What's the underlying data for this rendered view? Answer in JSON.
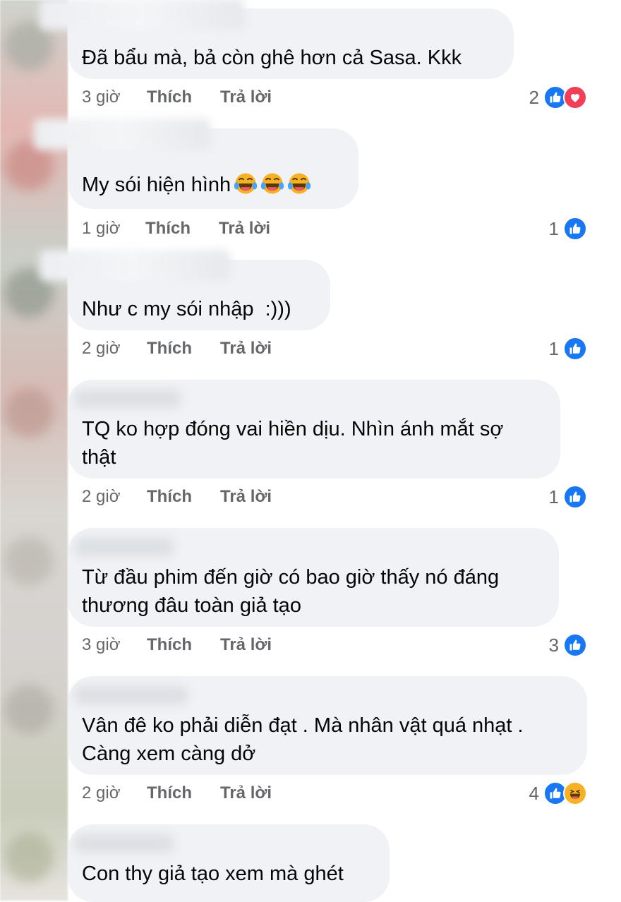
{
  "comments": [
    {
      "text": "Đã bẩu mà, bả còn ghê hơn cả Sasa. Kkk",
      "time": "3 giờ",
      "like": "Thích",
      "reply": "Trả lời",
      "count": "2",
      "reactions": [
        "like",
        "love"
      ]
    },
    {
      "text": "My sói hiện hình",
      "emojis": [
        "laughing-tears",
        "laughing-tears",
        "laughing-tears"
      ],
      "time": "1 giờ",
      "like": "Thích",
      "reply": "Trả lời",
      "count": "1",
      "reactions": [
        "like"
      ]
    },
    {
      "text": "Như c my sói nhập  :)))",
      "time": "2 giờ",
      "like": "Thích",
      "reply": "Trả lời",
      "count": "1",
      "reactions": [
        "like"
      ]
    },
    {
      "text_lines": [
        "TQ ko hợp đóng vai hiền dịu. Nhìn ánh mắt sợ",
        "thật"
      ],
      "time": "2 giờ",
      "like": "Thích",
      "reply": "Trả lời",
      "count": "1",
      "reactions": [
        "like"
      ]
    },
    {
      "text_lines": [
        "Từ đầu phim đến giờ có bao giờ thấy nó đáng",
        "thương đâu toàn giả tạo"
      ],
      "time": "3 giờ",
      "like": "Thích",
      "reply": "Trả lời",
      "count": "3",
      "reactions": [
        "like"
      ]
    },
    {
      "text_lines": [
        "Vân đê ko phải diễn đạt . Mà nhân vật quá nhạt .",
        "Càng xem càng dở"
      ],
      "time": "2 giờ",
      "like": "Thích",
      "reply": "Trả lời",
      "count": "4",
      "reactions": [
        "like",
        "haha"
      ]
    },
    {
      "text": "Con thy giả tạo xem mà ghét"
    }
  ],
  "colors": {
    "like": "#1877f2",
    "love": "#f33e58",
    "haha": "#f7b125",
    "bubble": "#f0f2f5",
    "meta": "#65676b"
  }
}
